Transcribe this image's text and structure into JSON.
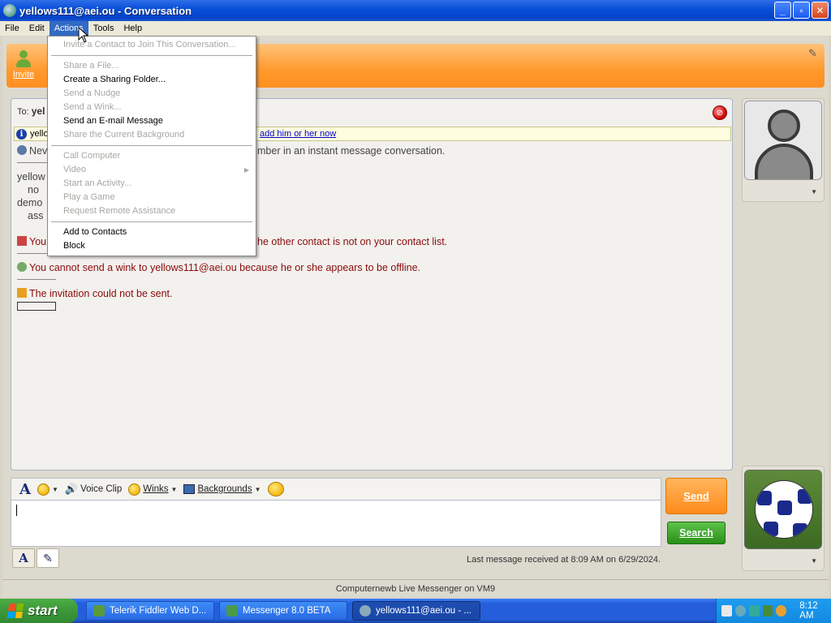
{
  "window": {
    "title": "yellows111@aei.ou - Conversation",
    "buttons": {
      "minimize": "_",
      "maximize": "▫",
      "close": "✕"
    }
  },
  "menubar": [
    "File",
    "Edit",
    "Actions",
    "Tools",
    "Help"
  ],
  "toolbar": {
    "invite_label": "Invite",
    "second_label_fragment": "S"
  },
  "conversation": {
    "to_label": "To:",
    "to_name_fragment": "yel",
    "info_name_fragment": "yello",
    "info_link": "add him or her now",
    "messages": [
      {
        "text_fragment": "Nev",
        "tail": "mber in an instant message conversation."
      },
      {
        "text_fragment": "yellow"
      },
      {
        "text_fragment": "no"
      },
      {
        "text_fragment": "demo"
      },
      {
        "text_fragment": "ass"
      },
      {
        "text_fragment": "You",
        "tail": "he other contact is not on your contact list."
      },
      {
        "text": "You cannot send a wink to yellows111@aei.ou because he or she appears to be offline."
      },
      {
        "text": "The invitation could not be sent."
      }
    ]
  },
  "actions_menu": {
    "items": [
      {
        "label": "Invite a Contact to Join This Conversation...",
        "enabled": false
      },
      {
        "separator": true
      },
      {
        "label": "Share a File...",
        "enabled": false
      },
      {
        "label": "Create a Sharing Folder...",
        "enabled": true
      },
      {
        "label": "Send a Nudge",
        "enabled": false
      },
      {
        "label": "Send a Wink...",
        "enabled": false
      },
      {
        "label": "Send an E-mail Message",
        "enabled": true
      },
      {
        "label": "Share the Current Background",
        "enabled": false
      },
      {
        "separator": true
      },
      {
        "label": "Call Computer",
        "enabled": false
      },
      {
        "label": "Video",
        "enabled": false,
        "submenu": true
      },
      {
        "label": "Start an Activity...",
        "enabled": false
      },
      {
        "label": "Play a Game",
        "enabled": false
      },
      {
        "label": "Request Remote Assistance",
        "enabled": false
      },
      {
        "separator": true
      },
      {
        "label": "Add to Contacts",
        "enabled": true
      },
      {
        "label": "Block",
        "enabled": true
      }
    ]
  },
  "compose": {
    "toolbar": {
      "voice_clip": "Voice Clip",
      "winks": "Winks",
      "backgrounds": "Backgrounds"
    },
    "send_label": "Send",
    "search_label": "Search",
    "last_message": "Last message received at 8:09 AM on 6/29/2024."
  },
  "status_strip": "Computernewb Live Messenger on VM9",
  "taskbar": {
    "start_label": "start",
    "tasks": [
      {
        "label": "Telerik Fiddler Web D...",
        "active": false
      },
      {
        "label": "Messenger 8.0 BETA",
        "active": false
      },
      {
        "label": "yellows111@aei.ou - ...",
        "active": true
      }
    ],
    "clock": "8:12 AM"
  },
  "colors": {
    "title_blue": "#0a50d8",
    "orange_toolbar": "#ff9a2e",
    "send_orange": "#ff8a1c",
    "search_green": "#2a8f18",
    "error_red": "#8a0c0c",
    "link_blue": "#0000cc"
  },
  "icons": {
    "app": "messenger-icon",
    "info": "info-icon",
    "block": "block-icon",
    "avatar": "default-avatar",
    "display_picture": "soccer-ball"
  }
}
